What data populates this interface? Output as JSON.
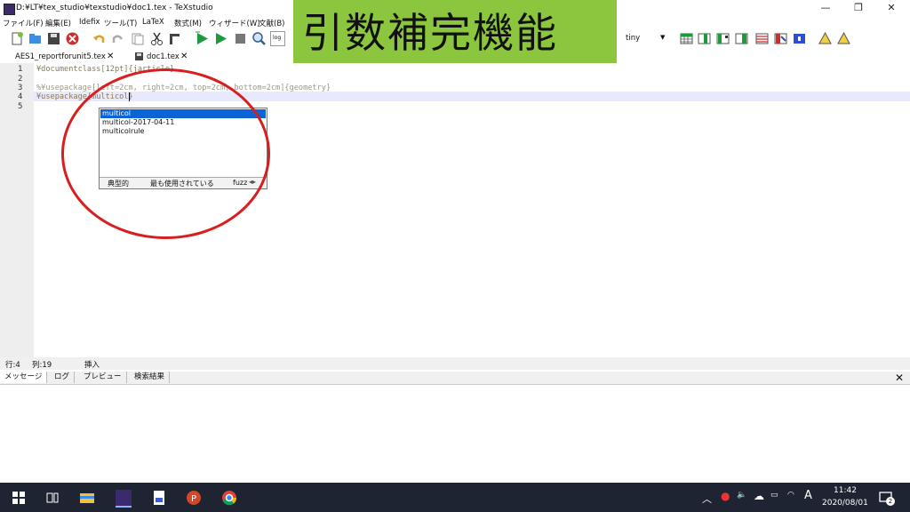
{
  "window": {
    "title": "D:¥LT¥tex_studio¥texstudio¥doc1.tex - TeXstudio",
    "minimize_glyph": "—",
    "restore_glyph": "❐",
    "close_glyph": "✕"
  },
  "menu": {
    "items": [
      "ファイル(F)",
      "編集(E)",
      "Idefix",
      "ツール(T)",
      "LaTeX",
      "数式(M)",
      "ウィザード(W)",
      "文献(B)"
    ]
  },
  "toolbar": {
    "font_size_value": "tiny",
    "dropdown_glyph": "▼",
    "log_label": "log"
  },
  "callout": {
    "text": "引数補完機能",
    "color": "#8cc63f"
  },
  "tabs": [
    {
      "label": "AES1_reportforunit5.tex"
    },
    {
      "label": "doc1.tex"
    }
  ],
  "editor": {
    "line_numbers": [
      "1",
      "2",
      "3",
      "4",
      "5"
    ],
    "lines": [
      "¥documentclass[12pt]{jarticle}",
      "",
      "%¥usepackage[left=2cm, right=2cm, top=2cm, bottom=2cm]{geometry}",
      "¥usepackage{multicol}",
      ""
    ]
  },
  "completion": {
    "items": [
      "multicol",
      "multicol-2017-04-11",
      "multicolrule"
    ],
    "selected_index": 0,
    "tabs": [
      "典型的",
      "最も使用されている",
      "fuzz"
    ]
  },
  "status": {
    "row": "行:4",
    "col": "列:19",
    "mode": "挿入"
  },
  "bottom_tabs": [
    "メッセージ",
    "ログ",
    "プレビュー",
    "検索結果"
  ],
  "taskbar": {
    "time": "11:42",
    "date": "2020/08/01",
    "ime": "A",
    "notification_count": "2"
  },
  "colors": {
    "selection": "#0a64d8",
    "annotation_ring": "#d81f1f",
    "taskbar": "#1f2433"
  }
}
